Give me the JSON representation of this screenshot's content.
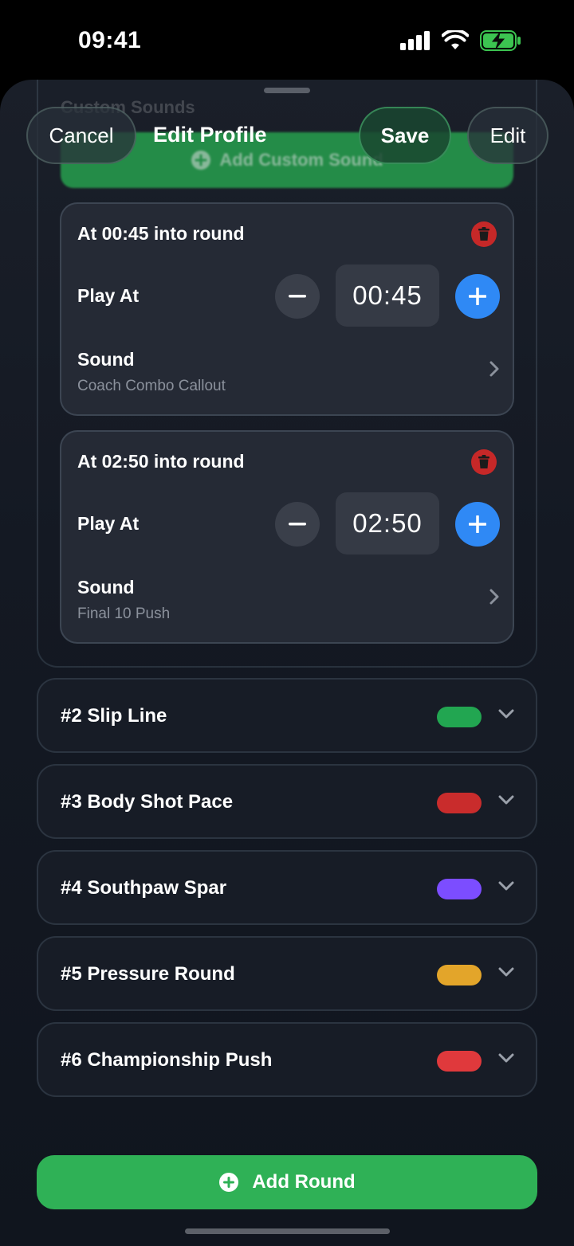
{
  "status_bar": {
    "time": "09:41"
  },
  "nav": {
    "cancel_label": "Cancel",
    "title": "Edit Profile",
    "save_label": "Save",
    "edit_label": "Edit"
  },
  "ghost": {
    "section_title": "Custom Sounds",
    "add_custom_sound_label": "Add Custom Sound"
  },
  "cues": [
    {
      "title": "At 00:45 into round",
      "play_at_label": "Play At",
      "time": "00:45",
      "sound_label": "Sound",
      "sound_value": "Coach Combo Callout"
    },
    {
      "title": "At 02:50 into round",
      "play_at_label": "Play At",
      "time": "02:50",
      "sound_label": "Sound",
      "sound_value": "Final 10 Push"
    }
  ],
  "rounds": [
    {
      "label": "#2 Slip Line",
      "color": "#22a651"
    },
    {
      "label": "#3 Body Shot Pace",
      "color": "#c92c2c"
    },
    {
      "label": "#4 Southpaw Spar",
      "color": "#7c4dff"
    },
    {
      "label": "#5 Pressure Round",
      "color": "#e3a52a"
    },
    {
      "label": "#6 Championship Push",
      "color": "#e0393c"
    }
  ],
  "add_round_label": "Add Round",
  "colors": {
    "accent_blue": "#2f89f5",
    "accent_green": "#2fb156",
    "delete_red": "#c62828"
  }
}
